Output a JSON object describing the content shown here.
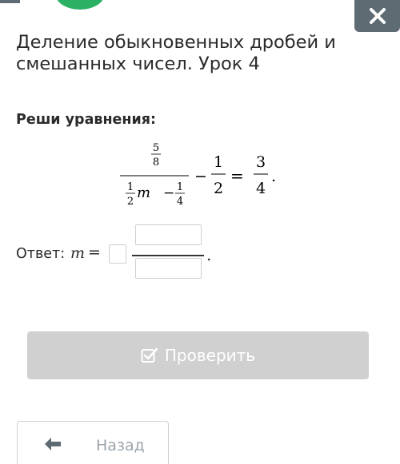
{
  "header": {
    "close_icon": "close-icon",
    "progress_color": "#2ab164"
  },
  "lesson": {
    "title": "Деление обыкновенных дробей и смешанных чисел. Урок 4"
  },
  "task": {
    "label": "Реши уравнения:",
    "equation": {
      "outer_numerator": {
        "num": "5",
        "den": "8"
      },
      "denominator_term1": {
        "num": "1",
        "den": "2",
        "var": "m"
      },
      "denominator_minus": "−",
      "denominator_term2": {
        "num": "1",
        "den": "4"
      },
      "minus": "−",
      "subtrahend": {
        "num": "1",
        "den": "2"
      },
      "equals": "=",
      "rhs": {
        "num": "3",
        "den": "4"
      },
      "period": "."
    }
  },
  "answer": {
    "label": "Ответ:",
    "variable": "m",
    "equals": "=",
    "whole_value": "",
    "numerator_value": "",
    "denominator_value": "",
    "period": "."
  },
  "buttons": {
    "check_label": "Проверить",
    "check_icon": "check-square-icon",
    "back_label": "Назад",
    "back_icon": "arrow-left-icon"
  }
}
